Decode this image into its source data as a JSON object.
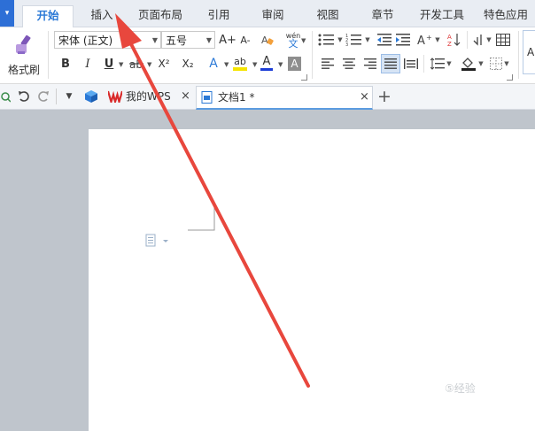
{
  "menu": {
    "tabs": [
      "开始",
      "插入",
      "页面布局",
      "引用",
      "审阅",
      "视图",
      "章节",
      "开发工具",
      "特色应用"
    ]
  },
  "ribbon": {
    "format_painter": "格式刷",
    "font_name": "宋体 (正文)",
    "font_size": "五号",
    "font_grow": "A+",
    "font_shrink": "A-",
    "phonetic_top": "wén",
    "phonetic_bottom": "文",
    "bold": "B",
    "italic": "I",
    "underline": "U",
    "superscript": "X²",
    "subscript": "X₂",
    "text_effect": "A",
    "font_color": "A",
    "char_shading": "A",
    "highlight": "ab",
    "style_preview": "Aa"
  },
  "quick_access": {
    "doc_tabs": [
      {
        "label": "我的WPS"
      },
      {
        "label": "文档1 *"
      }
    ],
    "new_tab": "+"
  },
  "colors": {
    "accent": "#2b79d6",
    "annotation_arrow": "#e8473d",
    "workspace_bg": "#bfc5cc"
  },
  "watermark": "⑤经验"
}
